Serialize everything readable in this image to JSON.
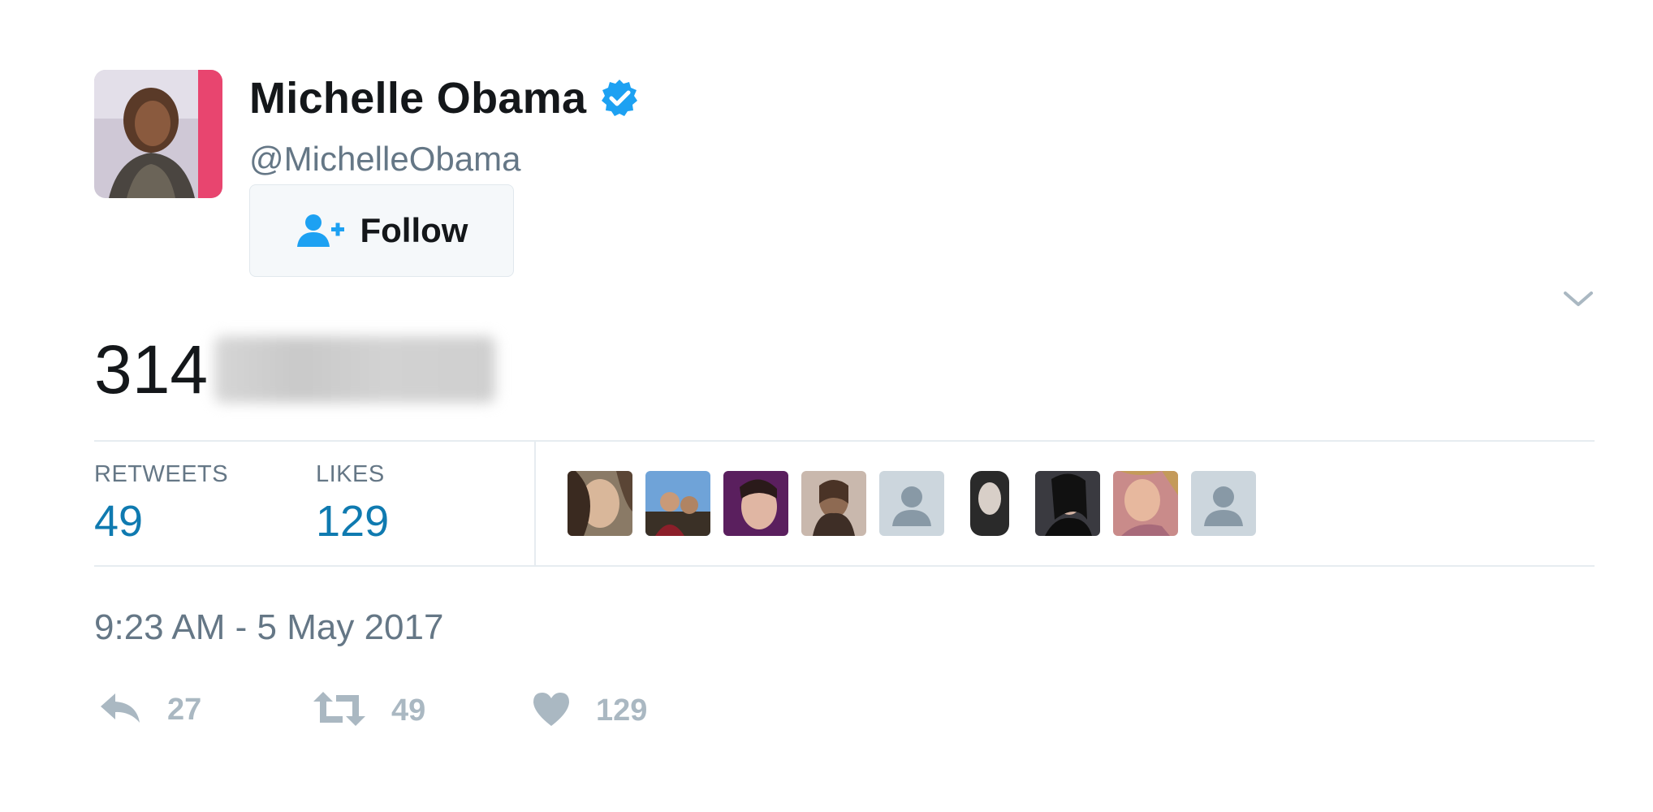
{
  "user": {
    "display_name": "Michelle Obama",
    "handle": "@MichelleObama",
    "verified": true
  },
  "follow_button": {
    "label": "Follow",
    "icon": "add-user-icon"
  },
  "tweet": {
    "text_visible": "314",
    "text_obscured": true
  },
  "stats": {
    "retweets_label": "RETWEETS",
    "retweets_value": "49",
    "likes_label": "LIKES",
    "likes_value": "129"
  },
  "timestamp": "9:23 AM - 5 May 2017",
  "actions": {
    "reply_count": "27",
    "retweet_count": "49",
    "like_count": "129"
  },
  "colors": {
    "link_blue": "#0f7ab0",
    "verified_blue": "#1da1f2",
    "muted_gray": "#657786",
    "action_gray": "#aab8c2",
    "border": "#e6ecf0"
  }
}
